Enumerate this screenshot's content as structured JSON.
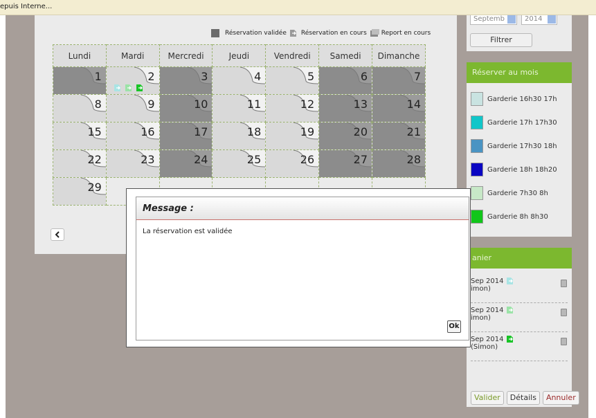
{
  "browser": {
    "status_text": "epuis Interne..."
  },
  "legend": {
    "validated": "Réservation validée",
    "in_progress": "Réservation en cours",
    "report": "Report en cours"
  },
  "calendar": {
    "days_header": [
      "Lundi",
      "Mardi",
      "Mercredi",
      "Jeudi",
      "Vendredi",
      "Samedi",
      "Dimanche"
    ],
    "weeks": [
      [
        {
          "n": "1",
          "t": "dark"
        },
        {
          "n": "2",
          "t": "light",
          "marks": 3
        },
        {
          "n": "3",
          "t": "dark"
        },
        {
          "n": "4",
          "t": "light"
        },
        {
          "n": "5",
          "t": "light"
        },
        {
          "n": "6",
          "t": "dark"
        },
        {
          "n": "7",
          "t": "dark"
        }
      ],
      [
        {
          "n": "8",
          "t": "light"
        },
        {
          "n": "9",
          "t": "light"
        },
        {
          "n": "10",
          "t": "dark"
        },
        {
          "n": "11",
          "t": "light"
        },
        {
          "n": "12",
          "t": "light"
        },
        {
          "n": "13",
          "t": "dark"
        },
        {
          "n": "14",
          "t": "dark"
        }
      ],
      [
        {
          "n": "15",
          "t": "light"
        },
        {
          "n": "16",
          "t": "light"
        },
        {
          "n": "17",
          "t": "dark"
        },
        {
          "n": "18",
          "t": "light"
        },
        {
          "n": "19",
          "t": "light"
        },
        {
          "n": "20",
          "t": "dark"
        },
        {
          "n": "21",
          "t": "dark"
        }
      ],
      [
        {
          "n": "22",
          "t": "light"
        },
        {
          "n": "23",
          "t": "light"
        },
        {
          "n": "24",
          "t": "dark"
        },
        {
          "n": "25",
          "t": "light"
        },
        {
          "n": "26",
          "t": "light"
        },
        {
          "n": "27",
          "t": "dark"
        },
        {
          "n": "28",
          "t": "dark"
        }
      ],
      [
        {
          "n": "29",
          "t": "light"
        },
        {
          "n": "",
          "t": "empty"
        },
        {
          "n": "",
          "t": "empty"
        },
        {
          "n": "",
          "t": "empty"
        },
        {
          "n": "",
          "t": "empty"
        },
        {
          "n": "",
          "t": "empty"
        },
        {
          "n": "",
          "t": "empty"
        }
      ]
    ]
  },
  "filter": {
    "month_value": "Septemb",
    "year_value": "2014",
    "button_label": "Filtrer"
  },
  "month_reserve": {
    "title": "Réserver au mois",
    "slots": [
      {
        "label": "Garderie 16h30 17h",
        "color": "#c9e3e1"
      },
      {
        "label": "Garderie 17h 17h30",
        "color": "#11c6c9"
      },
      {
        "label": "Garderie 17h30 18h",
        "color": "#4a94c3"
      },
      {
        "label": "Garderie 18h 18h20",
        "color": "#0a05c2"
      },
      {
        "label": "Garderie 7h30 8h",
        "color": "#c7e8c7"
      },
      {
        "label": "Garderie 8h 8h30",
        "color": "#11c61a"
      }
    ]
  },
  "cart": {
    "title": "anier",
    "items": [
      {
        "line1": "Sep 2014",
        "line2": "imon)",
        "icon_color": "#a8e4e4"
      },
      {
        "line1": "Sep 2014",
        "line2": "imon)",
        "icon_color": "#9be3a7"
      },
      {
        "line1": "Sep 2014",
        "line2": "(Simon)",
        "icon_color": "#18c426"
      }
    ],
    "buttons": {
      "validate": "Valider",
      "details": "Détails",
      "cancel": "Annuler"
    }
  },
  "modal": {
    "title": "Message :",
    "text": "La réservation est validée",
    "ok_label": "Ok"
  },
  "colors": {
    "accent_green": "#7cb82f",
    "mark_light": "#a8e4e4",
    "mark_mid": "#9be3a7",
    "mark_strong": "#18c426"
  }
}
